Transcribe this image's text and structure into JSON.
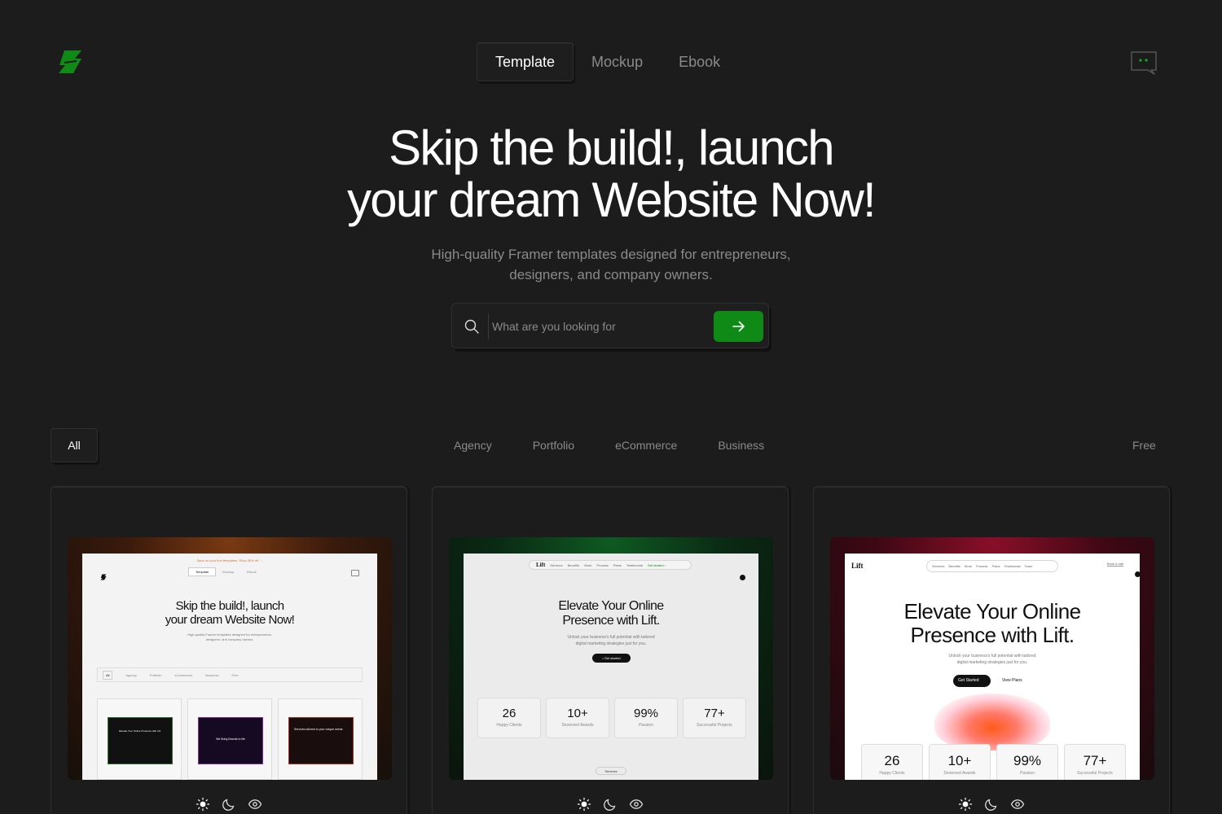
{
  "colors": {
    "accent": "#0f8a17",
    "background": "#1c1c1c",
    "muted": "#8a8a8a"
  },
  "header": {
    "logo_icon": "brand-logo-icon",
    "tabs": [
      {
        "label": "Template",
        "active": true
      },
      {
        "label": "Mockup",
        "active": false
      },
      {
        "label": "Ebook",
        "active": false
      }
    ],
    "chat_icon": "chat-icon"
  },
  "hero": {
    "title_line1": "Skip the build!, launch",
    "title_line2": "your dream Website Now!",
    "subtitle_line1": "High-quality Framer templates designed for entrepreneurs,",
    "subtitle_line2": "designers, and company owners."
  },
  "search": {
    "placeholder": "What are you looking for",
    "value": "",
    "icon": "search-icon",
    "submit_icon": "arrow-right-icon"
  },
  "categories": {
    "all": "All",
    "items": [
      "Agency",
      "Portfolio",
      "eCommerce",
      "Business"
    ],
    "free": "Free"
  },
  "cards": [
    {
      "preview": {
        "banner": "Save on your first templates. Shop 30% off  →",
        "tabs": [
          "Template",
          "Mockup",
          "Ebook"
        ],
        "title_line1": "Skip the build!, launch",
        "title_line2": "your dream Website Now!",
        "subtitle_line1": "High-quality Framer templates designed for entrepreneurs,",
        "subtitle_line2": "designers, and company owners.",
        "filters": [
          "All",
          "Agency",
          "Portfolio",
          "eCommerce",
          "Business",
          "Free"
        ],
        "thumbs": [
          "Elevate Your Online Presence with Lift.",
          "We Bring Brands to life",
          "Services tailored to your unique needs"
        ]
      },
      "icons": [
        "sun-icon",
        "moon-icon",
        "eye-icon"
      ]
    },
    {
      "preview": {
        "nav_logo": "Lift",
        "nav": [
          "Services",
          "Benefits",
          "Work",
          "Process",
          "Plans",
          "Testimonial"
        ],
        "nav_cta": "Get started ›",
        "title_line1": "Elevate Your Online",
        "title_line2": "Presence with Lift.",
        "subtitle_line1": "Unlock your business's full potential with tailored",
        "subtitle_line2": "digital marketing strategies just for you.",
        "cta": "• Get started",
        "stats": [
          {
            "value": "26",
            "label": "Happy Clients"
          },
          {
            "value": "10+",
            "label": "Deserved Awards"
          },
          {
            "value": "99%",
            "label": "Passion"
          },
          {
            "value": "77+",
            "label": "Successful Projects"
          }
        ],
        "footer_tag": "Services"
      },
      "icons": [
        "sun-icon",
        "moon-icon",
        "eye-icon"
      ]
    },
    {
      "preview": {
        "nav_logo": "Lift",
        "nav": [
          "Services",
          "Benefits",
          "Work",
          "Process",
          "Plans",
          "Testimonial",
          "Team"
        ],
        "nav_cta": "Book a call",
        "title_line1": "Elevate Your Online",
        "title_line2": "Presence with Lift.",
        "subtitle_line1": "Unlock your business's full potential with tailored",
        "subtitle_line2": "digital marketing strategies just for you.",
        "cta_primary": "Get Started",
        "cta_secondary": "View Plans",
        "stats": [
          {
            "value": "26",
            "label": "Happy Clients"
          },
          {
            "value": "10+",
            "label": "Deserved Awards"
          },
          {
            "value": "99%",
            "label": "Passion"
          },
          {
            "value": "77+",
            "label": "Successful Projects"
          }
        ]
      },
      "icons": [
        "sun-icon",
        "moon-icon",
        "eye-icon"
      ]
    }
  ]
}
